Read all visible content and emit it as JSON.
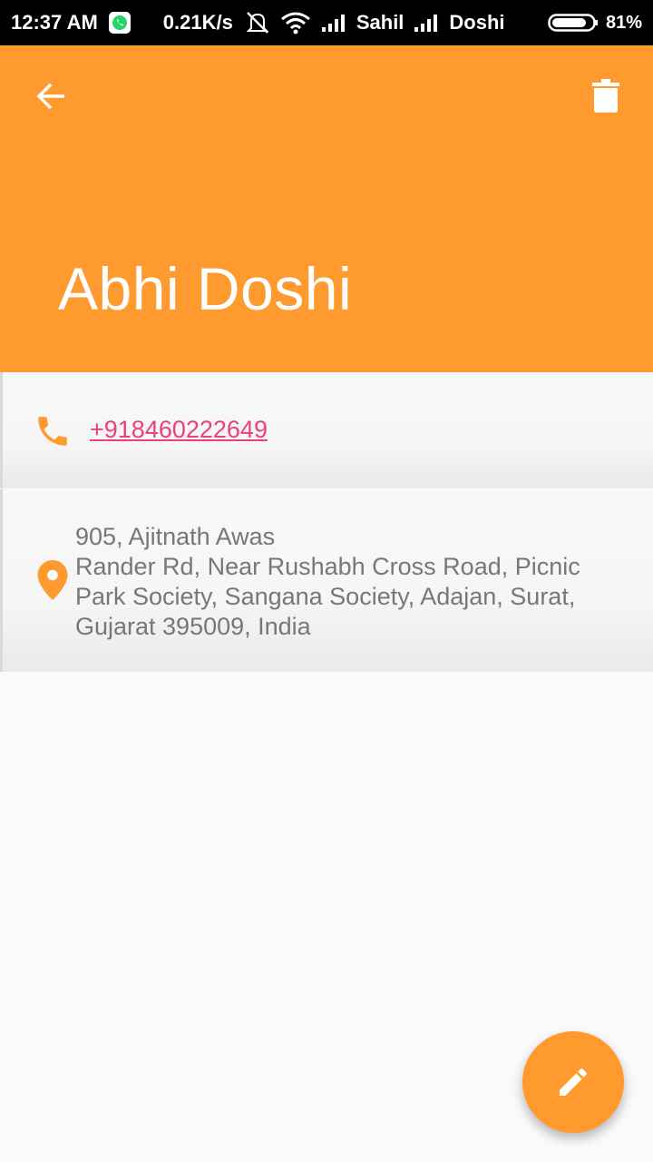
{
  "status_bar": {
    "time": "12:37 AM",
    "network_speed": "0.21K/s",
    "carrier_1": "Sahil",
    "carrier_2": "Doshi",
    "battery_percent": "81%",
    "icons": [
      "whatsapp-icon",
      "alarm-off-icon",
      "wifi-icon",
      "signal-icon",
      "signal-icon",
      "battery-icon"
    ]
  },
  "header": {
    "contact_name": "Abhi Doshi",
    "back_icon": "arrow-back-icon",
    "delete_icon": "trash-icon"
  },
  "phone": {
    "number": "+918460222649",
    "icon": "phone-icon"
  },
  "address": {
    "text": "905, Ajitnath Awas\nRander Rd, Near Rushabh Cross Road, Picnic\nPark Society, Sangana Society, Adajan, Surat,\nGujarat 395009, India",
    "icon": "location-pin-icon"
  },
  "fab": {
    "icon": "edit-pencil-icon"
  },
  "colors": {
    "accent": "#ff9a2f",
    "link": "#ec407a",
    "text_secondary": "#777777",
    "background": "#fafafa"
  }
}
